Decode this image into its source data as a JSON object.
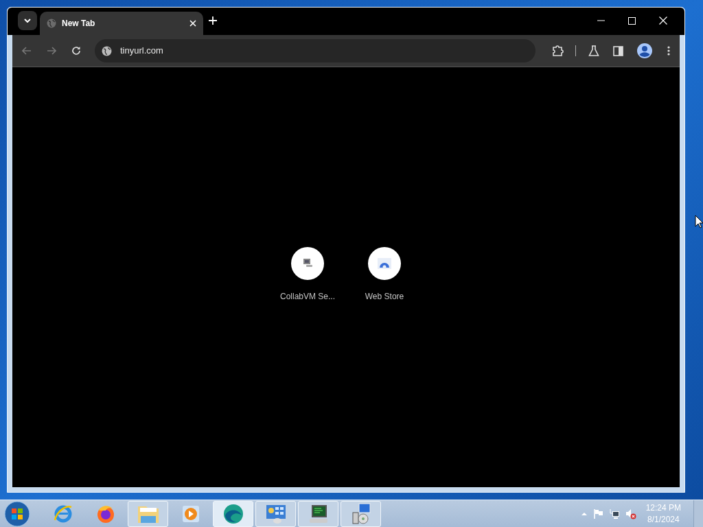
{
  "browser": {
    "tab": {
      "title": "New Tab",
      "selected": true
    },
    "address": "tinyurl.com",
    "shortcuts": [
      {
        "label": "CollabVM Se...",
        "kind": "computer"
      },
      {
        "label": "Web Store",
        "kind": "store"
      }
    ]
  },
  "taskbar": {
    "items": [
      {
        "kind": "ie",
        "running": false,
        "selected": false
      },
      {
        "kind": "firefox",
        "running": false,
        "selected": false
      },
      {
        "kind": "folder",
        "running": true,
        "selected": false
      },
      {
        "kind": "media",
        "running": false,
        "selected": false
      },
      {
        "kind": "edge",
        "running": true,
        "selected": true
      },
      {
        "kind": "panel",
        "running": true,
        "selected": false
      },
      {
        "kind": "monitor",
        "running": true,
        "selected": false
      },
      {
        "kind": "installer",
        "running": true,
        "selected": false
      }
    ],
    "clock": {
      "time": "12:24 PM",
      "date": "8/1/2024"
    }
  }
}
